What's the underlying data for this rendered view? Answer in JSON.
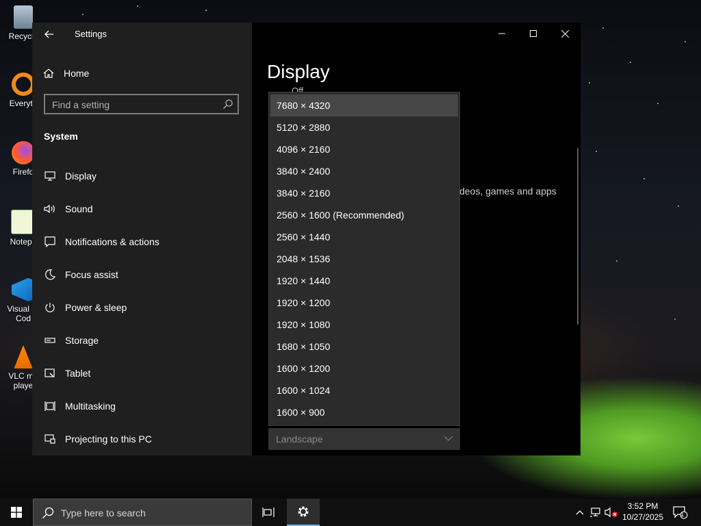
{
  "desktop": {
    "icons": [
      {
        "label": "Recycle"
      },
      {
        "label": "Everyth"
      },
      {
        "label": "Firefo"
      },
      {
        "label": "Notepa"
      },
      {
        "label": "Visual St Cod"
      },
      {
        "label": "VLC me playe"
      }
    ]
  },
  "window": {
    "title": "Settings",
    "home_label": "Home",
    "search_placeholder": "Find a setting",
    "section_title": "System",
    "nav_items": [
      {
        "label": "Display",
        "icon": "monitor-icon"
      },
      {
        "label": "Sound",
        "icon": "speaker-icon"
      },
      {
        "label": "Notifications & actions",
        "icon": "notification-icon"
      },
      {
        "label": "Focus assist",
        "icon": "moon-icon"
      },
      {
        "label": "Power & sleep",
        "icon": "power-icon"
      },
      {
        "label": "Storage",
        "icon": "storage-icon"
      },
      {
        "label": "Tablet",
        "icon": "tablet-icon"
      },
      {
        "label": "Multitasking",
        "icon": "multitasking-icon"
      },
      {
        "label": "Projecting to this PC",
        "icon": "projecting-icon"
      }
    ]
  },
  "content": {
    "page_title": "Display",
    "toggle_state": "Off",
    "partial_text": "ideos, games and apps",
    "partial_colon": ":"
  },
  "resolution_dropdown": {
    "options": [
      "7680 × 4320",
      "5120 × 2880",
      "4096 × 2160",
      "3840 × 2400",
      "3840 × 2160",
      "2560 × 1600 (Recommended)",
      "2560 × 1440",
      "2048 × 1536",
      "1920 × 1440",
      "1920 × 1200",
      "1920 × 1080",
      "1680 × 1050",
      "1600 × 1200",
      "1600 × 1024",
      "1600 × 900"
    ],
    "selected": "7680 × 4320"
  },
  "orientation": {
    "value": "Landscape"
  },
  "taskbar": {
    "search_placeholder": "Type here to search",
    "time": "3:52 PM",
    "date": "10/27/2025",
    "notification_count": "1"
  }
}
